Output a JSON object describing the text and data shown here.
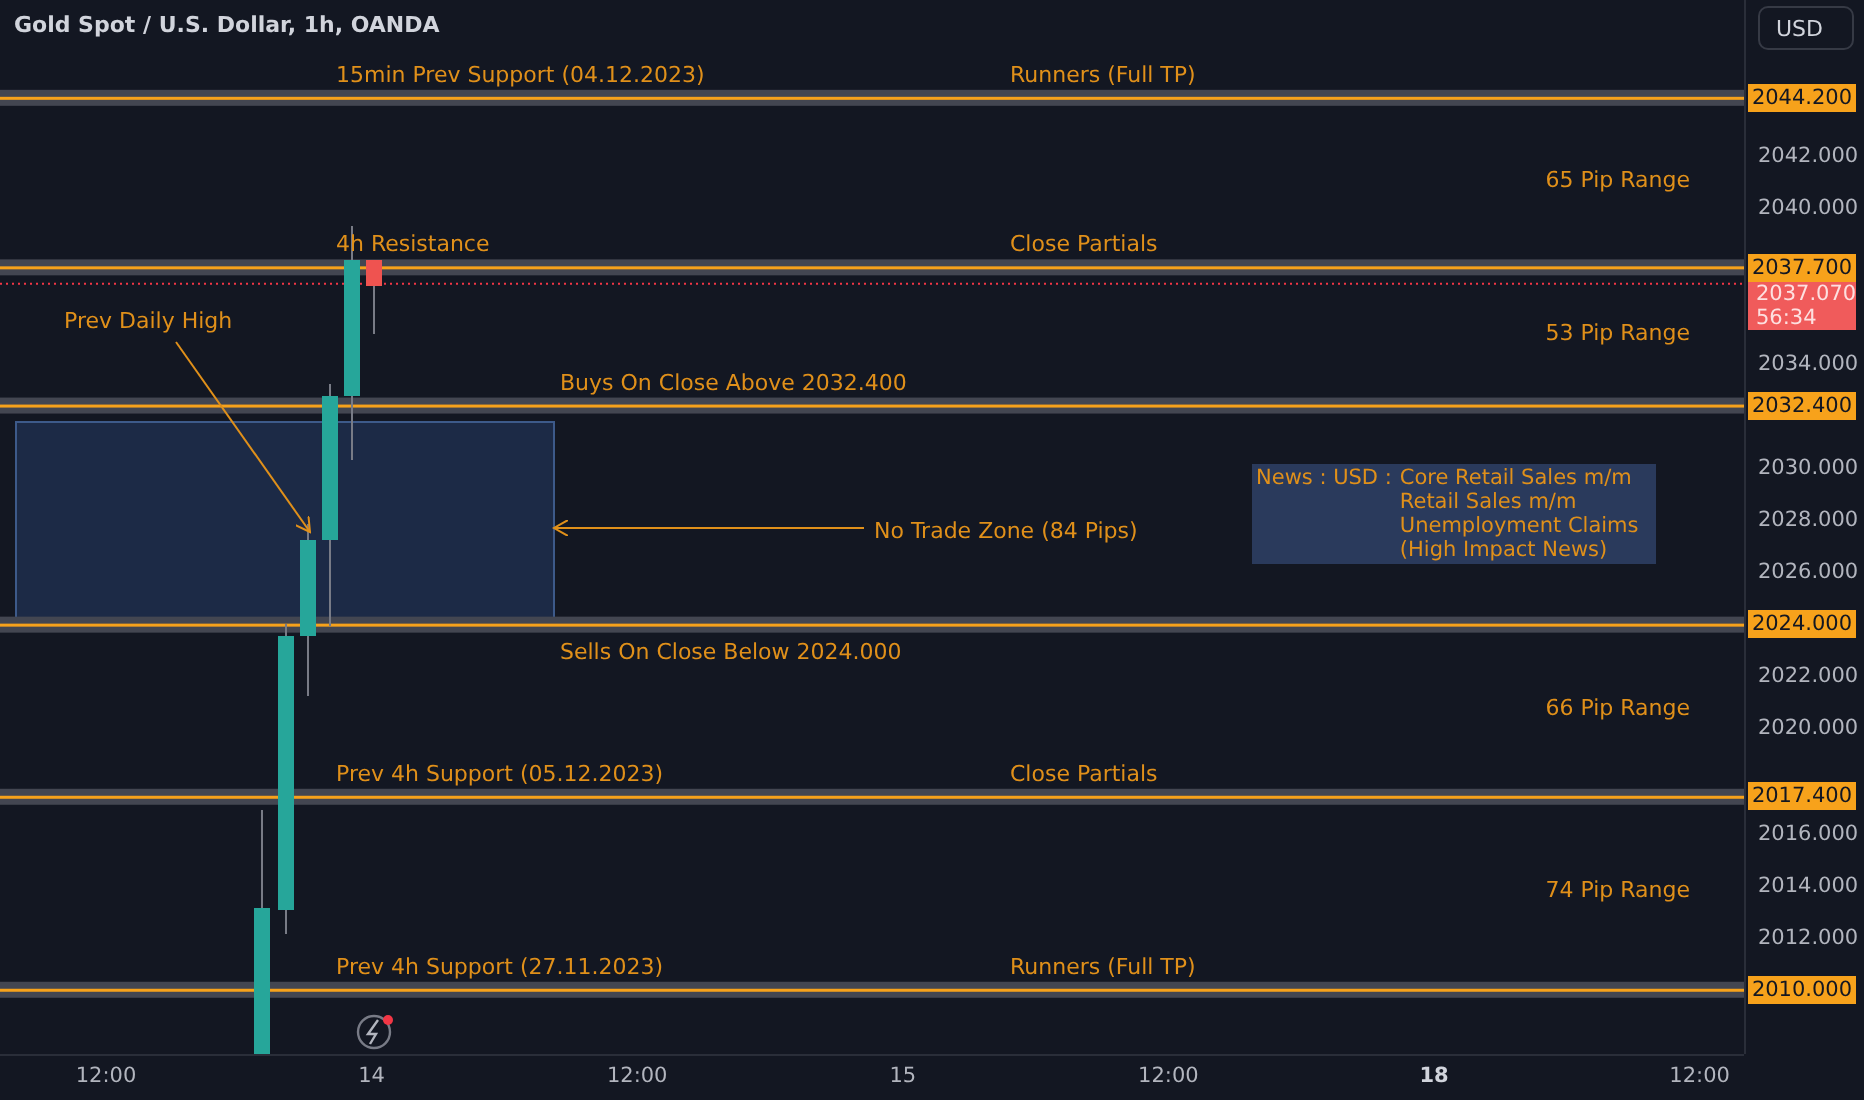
{
  "header": {
    "title": "Gold Spot / U.S. Dollar, 1h, OANDA",
    "currency_button": "USD"
  },
  "levels": [
    {
      "price": "2044.200",
      "left_label": "15min Prev Support (04.12.2023)",
      "right_label": "Runners (Full TP)",
      "range_below": "65 Pip Range"
    },
    {
      "price": "2037.700",
      "left_label": "4h Resistance",
      "right_label": "Close Partials",
      "range_below": "53 Pip Range"
    },
    {
      "price": "2032.400",
      "left_label": "Buys On Close Above 2032.400"
    },
    {
      "price": "2024.000",
      "left_label": "Sells On Close Below 2024.000",
      "range_below": "66 Pip Range"
    },
    {
      "price": "2017.400",
      "left_label": "Prev 4h Support (05.12.2023)",
      "right_label": "Close Partials",
      "range_below": "74 Pip Range"
    },
    {
      "price": "2010.000",
      "left_label": "Prev 4h Support (27.11.2023)",
      "right_label": "Runners (Full TP)"
    }
  ],
  "price_axis": {
    "ticks": [
      "2042.000",
      "2040.000",
      "2034.000",
      "2030.000",
      "2028.000",
      "2026.000",
      "2022.000",
      "2020.000",
      "2016.000",
      "2014.000",
      "2012.000"
    ]
  },
  "current_price": {
    "price": "2037.070",
    "countdown": "56:34"
  },
  "annotations": {
    "prev_daily_high": "Prev Daily High",
    "no_trade_zone": "No Trade Zone (84 Pips)"
  },
  "news": {
    "prefix": "News : USD :",
    "items": [
      "Core Retail Sales m/m",
      "Retail Sales m/m",
      "Unemployment Claims",
      "(High Impact News)"
    ]
  },
  "time_axis": [
    {
      "label": "12:00",
      "bold": false
    },
    {
      "label": "14",
      "bold": false
    },
    {
      "label": "12:00",
      "bold": false
    },
    {
      "label": "15",
      "bold": false
    },
    {
      "label": "12:00",
      "bold": false
    },
    {
      "label": "18",
      "bold": true
    },
    {
      "label": "12:00",
      "bold": false
    }
  ]
}
